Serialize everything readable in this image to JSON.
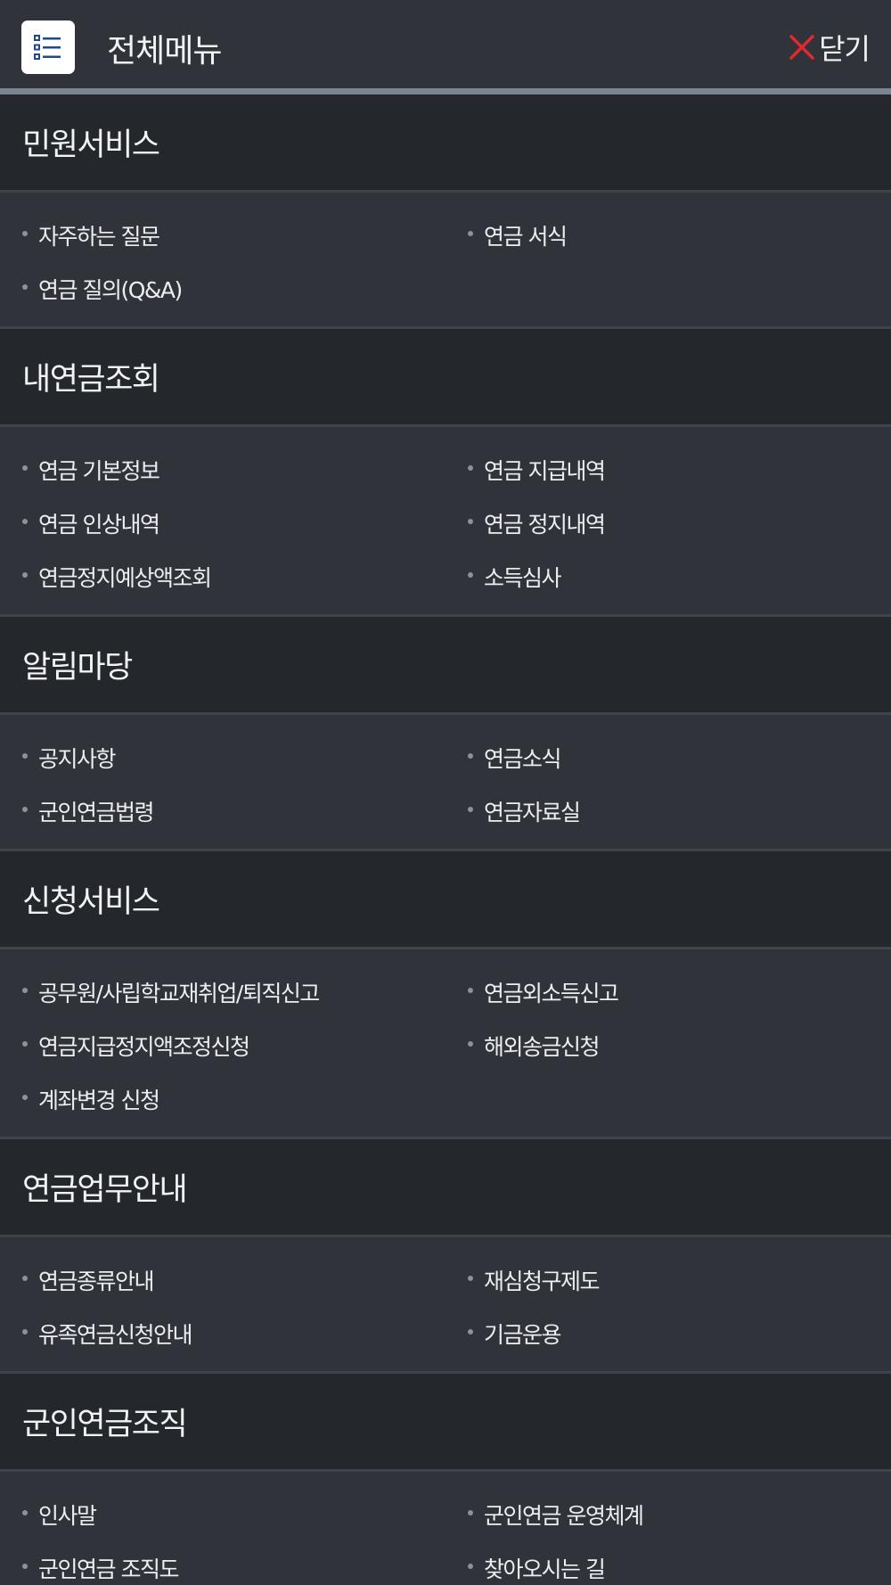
{
  "header": {
    "title": "전체메뉴",
    "close_label": "닫기",
    "menu_icon": "list-icon",
    "close_icon": "x-icon",
    "accent": "#e0282e"
  },
  "sections": [
    {
      "title": "민원서비스",
      "items": [
        "자주하는 질문",
        "연금 서식",
        "연금 질의(Q&A)"
      ]
    },
    {
      "title": "내연금조회",
      "items": [
        "연금 기본정보",
        "연금 지급내역",
        "연금 인상내역",
        "연금 정지내역",
        "연금정지예상액조회",
        "소득심사"
      ]
    },
    {
      "title": "알림마당",
      "items": [
        "공지사항",
        "연금소식",
        "군인연금법령",
        "연금자료실"
      ]
    },
    {
      "title": "신청서비스",
      "items": [
        "공무원/사립학교재취업/퇴직신고",
        "연금외소득신고",
        "연금지급정지액조정신청",
        "해외송금신청",
        "계좌변경 신청"
      ]
    },
    {
      "title": "연금업무안내",
      "items": [
        "연금종류안내",
        "재심청구제도",
        "유족연금신청안내",
        "기금운용"
      ]
    },
    {
      "title": "군인연금조직",
      "items": [
        "인사말",
        "군인연금 운영체계",
        "군인연금 조직도",
        "찾아오시는 길"
      ]
    }
  ]
}
